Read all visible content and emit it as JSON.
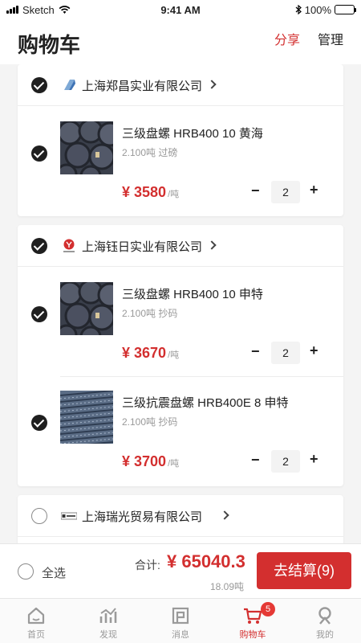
{
  "status_bar": {
    "carrier": "Sketch",
    "time": "9:41 AM",
    "battery": "100%"
  },
  "header": {
    "title": "购物车",
    "share_label": "分享",
    "manage_label": "管理"
  },
  "shops": [
    {
      "name": "上海郑昌实业有限公司",
      "checked": true,
      "items": [
        {
          "title": "三级盘螺 HRB400 10 黄海",
          "subtitle": "2.100吨 过磅",
          "price": "¥ 3580",
          "unit": "/吨",
          "qty": "2",
          "checked": true
        }
      ]
    },
    {
      "name": "上海钰日实业有限公司",
      "checked": true,
      "items": [
        {
          "title": "三级盘螺 HRB400 10 申特",
          "subtitle": "2.100吨 抄码",
          "price": "¥ 3670",
          "unit": "/吨",
          "qty": "2",
          "checked": true
        },
        {
          "title": "三级抗震盘螺 HRB400E 8 申特",
          "subtitle": "2.100吨 抄码",
          "price": "¥ 3700",
          "unit": "/吨",
          "qty": "2",
          "checked": true
        }
      ]
    },
    {
      "name": "上海瑞光贸易有限公司",
      "checked": false,
      "items": []
    }
  ],
  "qty_controls": {
    "minus": "−",
    "plus": "+"
  },
  "footer": {
    "select_all_label": "全选",
    "total_label": "合计:",
    "total_value": "¥ 65040.3",
    "total_weight": "18.09吨",
    "checkout_label": "去结算(9)"
  },
  "tabs": [
    {
      "label": "首页",
      "icon": "home-icon"
    },
    {
      "label": "发现",
      "icon": "trend-icon"
    },
    {
      "label": "消息",
      "icon": "message-icon"
    },
    {
      "label": "购物车",
      "icon": "cart-icon",
      "badge": "5",
      "active": true
    },
    {
      "label": "我的",
      "icon": "profile-icon"
    }
  ],
  "colors": {
    "accent": "#d32f2f",
    "check": "#1f1f1f"
  }
}
